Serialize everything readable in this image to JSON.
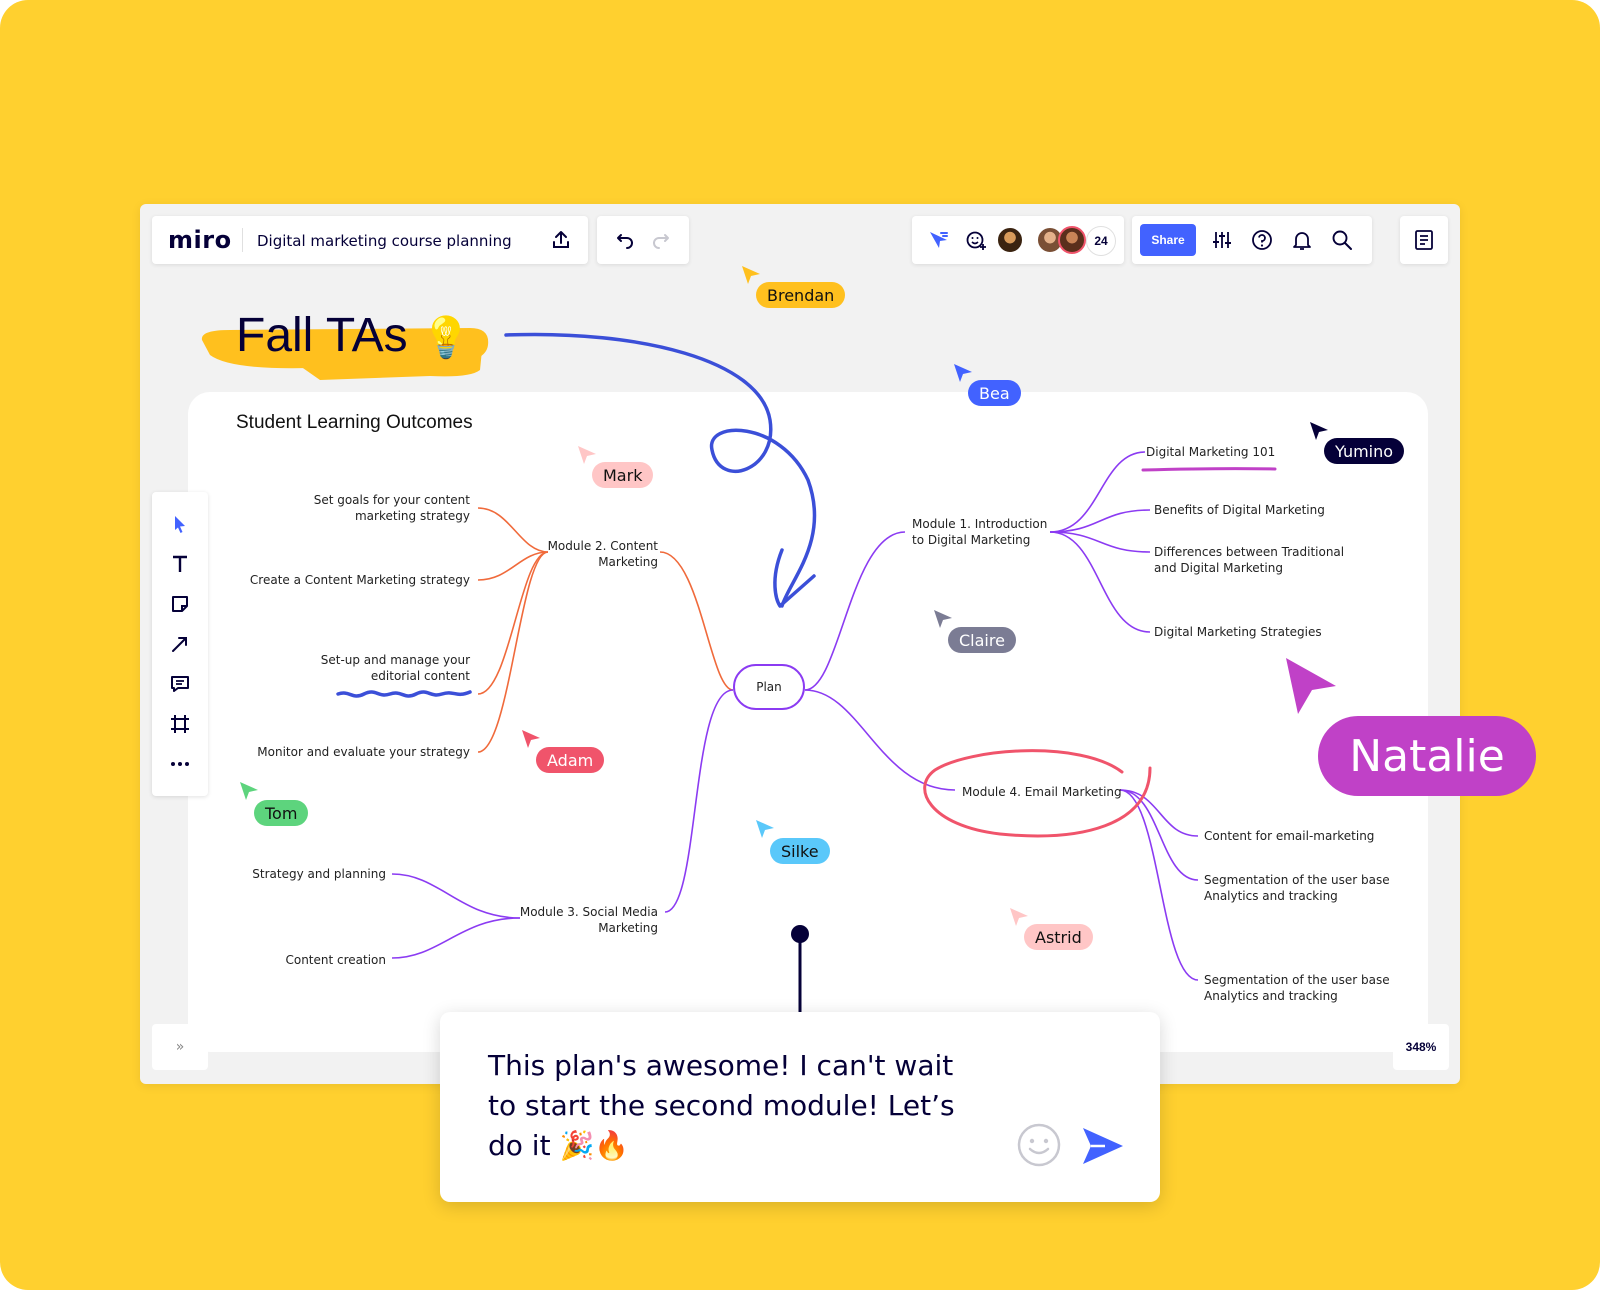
{
  "app": {
    "logo": "miro",
    "board_title": "Digital marketing course planning",
    "collaborator_count": "24",
    "share_label": "Share",
    "zoom_level": "348%",
    "expand_label": "»"
  },
  "icons": {
    "upload": "upload-icon",
    "undo": "undo-icon",
    "redo": "redo-icon",
    "cursor": "cursor-icon",
    "reactions": "reaction-add-icon",
    "settings": "sliders-icon",
    "help": "help-icon",
    "notifications": "bell-icon",
    "search": "search-icon",
    "notes": "notes-icon",
    "emoji": "smiley-icon",
    "send": "send-icon"
  },
  "colors": {
    "background": "#FFD02F",
    "accent": "#4262ff",
    "orange_branch": "#f06a3b",
    "purple_branch": "#8b3bf2",
    "pen_blue": "#3b4fd8",
    "pen_red": "#f0546b",
    "pen_magenta": "#c041c7"
  },
  "canvas": {
    "sticker_title": "Fall TAs",
    "sticker_emoji": "💡",
    "frame_title": "Student Learning Outcomes"
  },
  "mindmap": {
    "center": "Plan",
    "module1": {
      "label": "Module 1. Introduction\nto Digital Marketing",
      "children": [
        "Digital Marketing 101",
        "Benefits of Digital Marketing",
        "Differences between Traditional\nand Digital Marketing",
        "Digital Marketing Strategies"
      ]
    },
    "module2": {
      "label": "Module 2. Content\nMarketing",
      "children": [
        "Set goals for your content\nmarketing strategy",
        "Create a Content Marketing strategy",
        "Set-up and manage your\neditorial content",
        "Monitor and evaluate your strategy"
      ]
    },
    "module3": {
      "label": "Module 3. Social Media\nMarketing",
      "children": [
        "Strategy and planning",
        "Content creation"
      ]
    },
    "module4": {
      "label": "Module 4. Email Marketing",
      "children": [
        "Content for email-marketing",
        "Segmentation of the user base\nAnalytics and tracking",
        "Segmentation of the user base\nAnalytics and tracking"
      ]
    }
  },
  "cursors": [
    {
      "name": "Brendan",
      "color": "#FFD02F"
    },
    {
      "name": "Bea",
      "color": "#4262ff"
    },
    {
      "name": "Mark",
      "color": "#ffc6c6"
    },
    {
      "name": "Yumino",
      "color": "#050038"
    },
    {
      "name": "Claire",
      "color": "#7b7c94"
    },
    {
      "name": "Adam",
      "color": "#f0546b"
    },
    {
      "name": "Tom",
      "color": "#5dd47d"
    },
    {
      "name": "Silke",
      "color": "#5ac8fa"
    },
    {
      "name": "Astrid",
      "color": "#ffc6c6"
    },
    {
      "name": "Natalie",
      "color": "#c041c7"
    }
  ],
  "tools": [
    "select-tool",
    "text-tool",
    "sticky-note-tool",
    "connection-line-tool",
    "comment-tool",
    "frame-tool",
    "more-tools"
  ],
  "comment": {
    "text": "This plan's awesome! I can't wait to start the second module! Let’s do it 🎉🔥"
  }
}
